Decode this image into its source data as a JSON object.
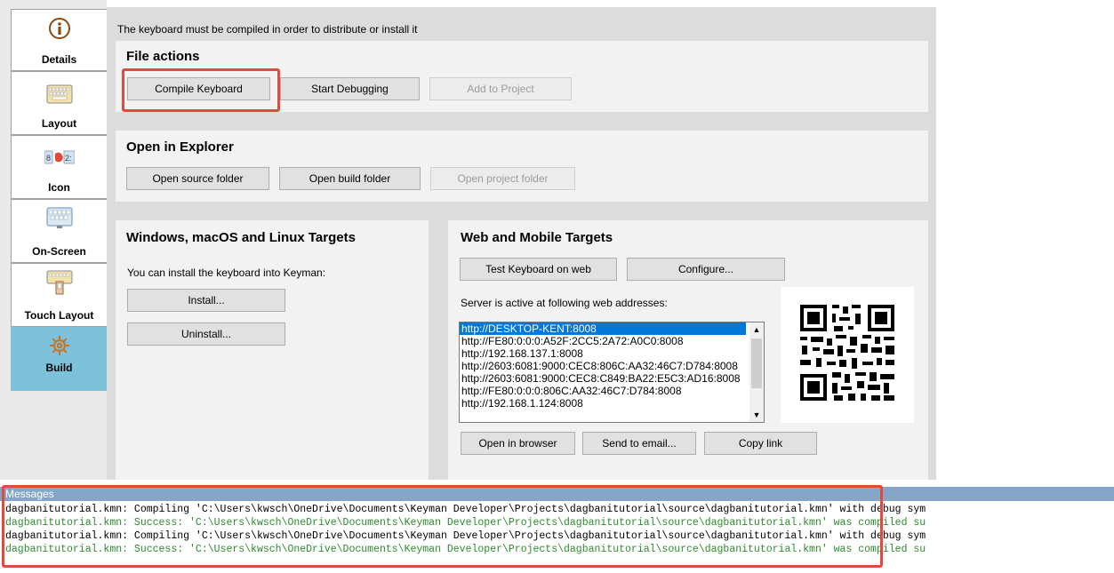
{
  "sidebar": {
    "tabs": [
      {
        "label": "Details",
        "icon": "info-icon"
      },
      {
        "label": "Layout",
        "icon": "keyboard-icon"
      },
      {
        "label": "Icon",
        "icon": "icon-editor-icon"
      },
      {
        "label": "On-Screen",
        "icon": "onscreen-keyboard-icon"
      },
      {
        "label": "Touch Layout",
        "icon": "touch-keyboard-icon"
      },
      {
        "label": "Build",
        "icon": "gear-icon"
      }
    ],
    "active_tab": "Build",
    "active_color": "#7ec1da"
  },
  "notice": "The keyboard must be compiled in order to distribute or install it",
  "file_actions": {
    "title": "File actions",
    "compile": "Compile Keyboard",
    "debug": "Start Debugging",
    "add_project": "Add to Project"
  },
  "explorer": {
    "title": "Open in Explorer",
    "source": "Open source folder",
    "build": "Open build folder",
    "project": "Open project folder"
  },
  "desktop_targets": {
    "title": "Windows, macOS and Linux Targets",
    "description": "You can install the keyboard into Keyman:",
    "install": "Install...",
    "uninstall": "Uninstall..."
  },
  "web_targets": {
    "title": "Web and Mobile Targets",
    "test": "Test Keyboard on web",
    "configure": "Configure...",
    "server_label": "Server is active at following web addresses:",
    "addresses": [
      "http://DESKTOP-KENT:8008",
      "http://FE80:0:0:0:A52F:2CC5:2A72:A0C0:8008",
      "http://192.168.137.1:8008",
      "http://2603:6081:9000:CEC8:806C:AA32:46C7:D784:8008",
      "http://2603:6081:9000:CEC8:C849:BA22:E5C3:AD16:8008",
      "http://FE80:0:0:0:806C:AA32:46C7:D784:8008",
      "http://192.168.1.124:8008"
    ],
    "selected_address": "http://DESKTOP-KENT:8008",
    "open_browser": "Open in browser",
    "send_email": "Send to email...",
    "copy_link": "Copy link"
  },
  "messages": {
    "title": "Messages",
    "lines": [
      {
        "text": "dagbanitutorial.kmn: Compiling 'C:\\Users\\kwsch\\OneDrive\\Documents\\Keyman Developer\\Projects\\dagbanitutorial\\source\\dagbanitutorial.kmn' with debug sym",
        "status": "info"
      },
      {
        "text": "dagbanitutorial.kmn: Success: 'C:\\Users\\kwsch\\OneDrive\\Documents\\Keyman Developer\\Projects\\dagbanitutorial\\source\\dagbanitutorial.kmn' was compiled su",
        "status": "success"
      },
      {
        "text": "dagbanitutorial.kmn: Compiling 'C:\\Users\\kwsch\\OneDrive\\Documents\\Keyman Developer\\Projects\\dagbanitutorial\\source\\dagbanitutorial.kmn' with debug sym",
        "status": "info"
      },
      {
        "text": "dagbanitutorial.kmn: Success: 'C:\\Users\\kwsch\\OneDrive\\Documents\\Keyman Developer\\Projects\\dagbanitutorial\\source\\dagbanitutorial.kmn' was compiled su",
        "status": "success"
      }
    ]
  },
  "colors": {
    "highlight": "#e04a3f",
    "success_text": "#2e8b2e",
    "messages_header": "#86a6c8",
    "selection": "#0078d7"
  }
}
